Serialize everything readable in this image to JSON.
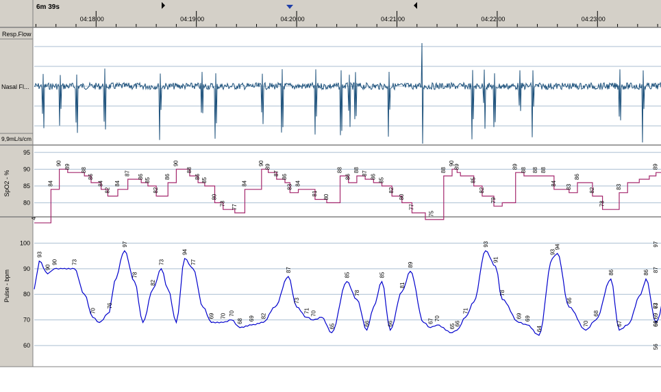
{
  "header": {
    "duration": "6m 39s",
    "times": [
      "04:18:00",
      "04:19:00",
      "04:20:00",
      "04:21:00",
      "04:22:00",
      "04:23:00"
    ]
  },
  "colors": {
    "background": "#ffffff",
    "panel": "#d4d0c8",
    "grid": "#a9bed1",
    "flow": "#1a4f7a",
    "spo2": "#a4266c",
    "spo2_label": "#000000",
    "pulse": "#0000cc",
    "marker": "#000000",
    "center_marker": "#1f3fa8"
  },
  "icons": [
    "left-marker-icon",
    "center-marker-icon",
    "right-marker-icon"
  ],
  "chart_data": [
    {
      "type": "line",
      "name": "resp-flow",
      "title": "Resp.Flow",
      "ylabel": "Nasal Fl...",
      "scale_label": "9,9mL/s/cm",
      "x_range_seconds": [
        0,
        399
      ],
      "spikes_at_seconds": [
        5,
        15,
        25,
        42,
        75,
        100,
        108,
        136,
        148,
        168,
        183,
        188,
        192,
        212,
        262,
        269,
        275,
        290,
        298,
        350,
        364,
        375,
        380,
        385
      ],
      "big_peak_at_seconds": 232
    },
    {
      "type": "line",
      "name": "spo2",
      "ylabel": "SpO2 - %",
      "ylim": [
        76,
        97
      ],
      "yticks": [
        80,
        85,
        90,
        95
      ],
      "x_seconds": [
        0,
        10,
        15,
        20,
        30,
        34,
        40,
        44,
        50,
        56,
        64,
        68,
        73,
        80,
        85,
        93,
        98,
        102,
        108,
        113,
        120,
        126,
        136,
        140,
        145,
        150,
        153,
        158,
        168,
        175,
        183,
        188,
        193,
        198,
        203,
        208,
        214,
        220,
        226,
        234,
        238,
        245,
        250,
        253,
        255,
        263,
        268,
        275,
        280,
        288,
        293,
        300,
        305,
        311,
        320,
        325,
        334,
        340,
        345,
        350,
        355,
        362,
        368,
        372,
        376,
        382,
        385,
        390,
        396
      ],
      "values": [
        74,
        84,
        90,
        89,
        88,
        86,
        84,
        82,
        84,
        87,
        86,
        85,
        82,
        86,
        90,
        88,
        86,
        85,
        80,
        78,
        77,
        84,
        90,
        89,
        87,
        86,
        83,
        84,
        81,
        80,
        88,
        86,
        88,
        87,
        86,
        85,
        82,
        80,
        77,
        75,
        75,
        88,
        90,
        89,
        88,
        85,
        82,
        79,
        80,
        89,
        88,
        88,
        88,
        84,
        83,
        86,
        82,
        78,
        78,
        83,
        86,
        87,
        88,
        89,
        88,
        89,
        88,
        89,
        89
      ],
      "labels": [
        "4",
        "84",
        "90",
        "89",
        "88",
        "86",
        "84",
        "82",
        "84",
        "87",
        "86",
        "85",
        "82",
        "86",
        "90",
        "88",
        "86",
        "85",
        "80",
        "78",
        "77",
        "84",
        "90",
        "89",
        "87",
        "86",
        "83",
        "84",
        "81",
        "80",
        "88",
        "86",
        "88",
        "87",
        "86",
        "85",
        "82",
        "80",
        "77",
        "75",
        "88",
        "90",
        "89",
        "85",
        "82",
        "79",
        "89",
        "88",
        "88",
        "88",
        "84",
        "83",
        "86",
        "82",
        "78",
        "83",
        "89",
        "89"
      ],
      "label_indices": [
        0,
        1,
        2,
        3,
        4,
        5,
        6,
        7,
        8,
        9,
        10,
        11,
        12,
        13,
        14,
        15,
        16,
        17,
        18,
        19,
        20,
        21,
        22,
        23,
        24,
        25,
        26,
        27,
        28,
        29,
        30,
        31,
        32,
        33,
        34,
        35,
        36,
        37,
        38,
        40,
        41,
        42,
        43,
        45,
        46,
        47,
        49,
        50,
        51,
        52,
        53,
        54,
        55,
        56,
        57,
        59,
        63,
        68
      ]
    },
    {
      "type": "line",
      "name": "pulse",
      "ylabel": "Pulse - bpm",
      "ylim": [
        52,
        110
      ],
      "yticks": [
        60,
        70,
        80,
        90,
        100
      ],
      "x_seconds": [
        0,
        3,
        8,
        12,
        17,
        24,
        30,
        35,
        39,
        45,
        48,
        54,
        60,
        65,
        71,
        76,
        80,
        85,
        90,
        95,
        101,
        106,
        113,
        118,
        123,
        130,
        137,
        144,
        152,
        157,
        163,
        167,
        172,
        178,
        187,
        193,
        199,
        203,
        208,
        213,
        220,
        225,
        233,
        237,
        241,
        250,
        253,
        258,
        263,
        270,
        276,
        280,
        290,
        295,
        302,
        310,
        313,
        320,
        330,
        336,
        345,
        350,
        355,
        363,
        366,
        372,
        380,
        386,
        390,
        396,
        399
      ],
      "values": [
        82,
        93,
        88,
        90,
        90,
        90,
        80,
        71,
        69,
        73,
        85,
        97,
        85,
        69,
        82,
        90,
        82,
        69,
        94,
        90,
        75,
        69,
        69,
        70,
        67,
        68,
        69,
        75,
        87,
        75,
        71,
        70,
        71,
        65,
        85,
        78,
        66,
        75,
        85,
        66,
        81,
        89,
        69,
        67,
        68,
        65,
        66,
        71,
        77,
        97,
        91,
        78,
        69,
        68,
        64,
        94,
        96,
        75,
        66,
        70,
        86,
        66,
        68,
        80,
        86,
        69,
        87,
        97,
        73,
        66,
        57
      ],
      "labels": [
        "93",
        "90",
        "90",
        "73",
        "70",
        "76",
        "97",
        "78",
        "82",
        "73",
        "94",
        "77",
        "69",
        "70",
        "70",
        "68",
        "69",
        "82",
        "87",
        "73",
        "71",
        "70",
        "65",
        "85",
        "78",
        "66",
        "85",
        "81",
        "66",
        "89",
        "67",
        "70",
        "65",
        "66",
        "71",
        "93",
        "91",
        "78",
        "69",
        "69",
        "64",
        "93",
        "94",
        "66",
        "70",
        "86",
        "68",
        "67",
        "86",
        "69",
        "87",
        "97",
        "73",
        "66",
        "67",
        "61",
        "56"
      ],
      "label_indices": [
        1,
        2,
        3,
        5,
        7,
        9,
        11,
        12,
        14,
        15,
        18,
        19,
        21,
        22,
        23,
        24,
        25,
        26,
        28,
        29,
        30,
        31,
        33,
        34,
        35,
        36,
        38,
        40,
        39,
        41,
        43,
        44,
        45,
        46,
        47,
        49,
        50,
        51,
        52,
        53,
        54,
        55,
        56,
        57,
        58,
        60,
        59,
        61,
        64,
        65,
        66,
        67,
        68,
        69,
        68,
        69,
        70
      ]
    }
  ]
}
